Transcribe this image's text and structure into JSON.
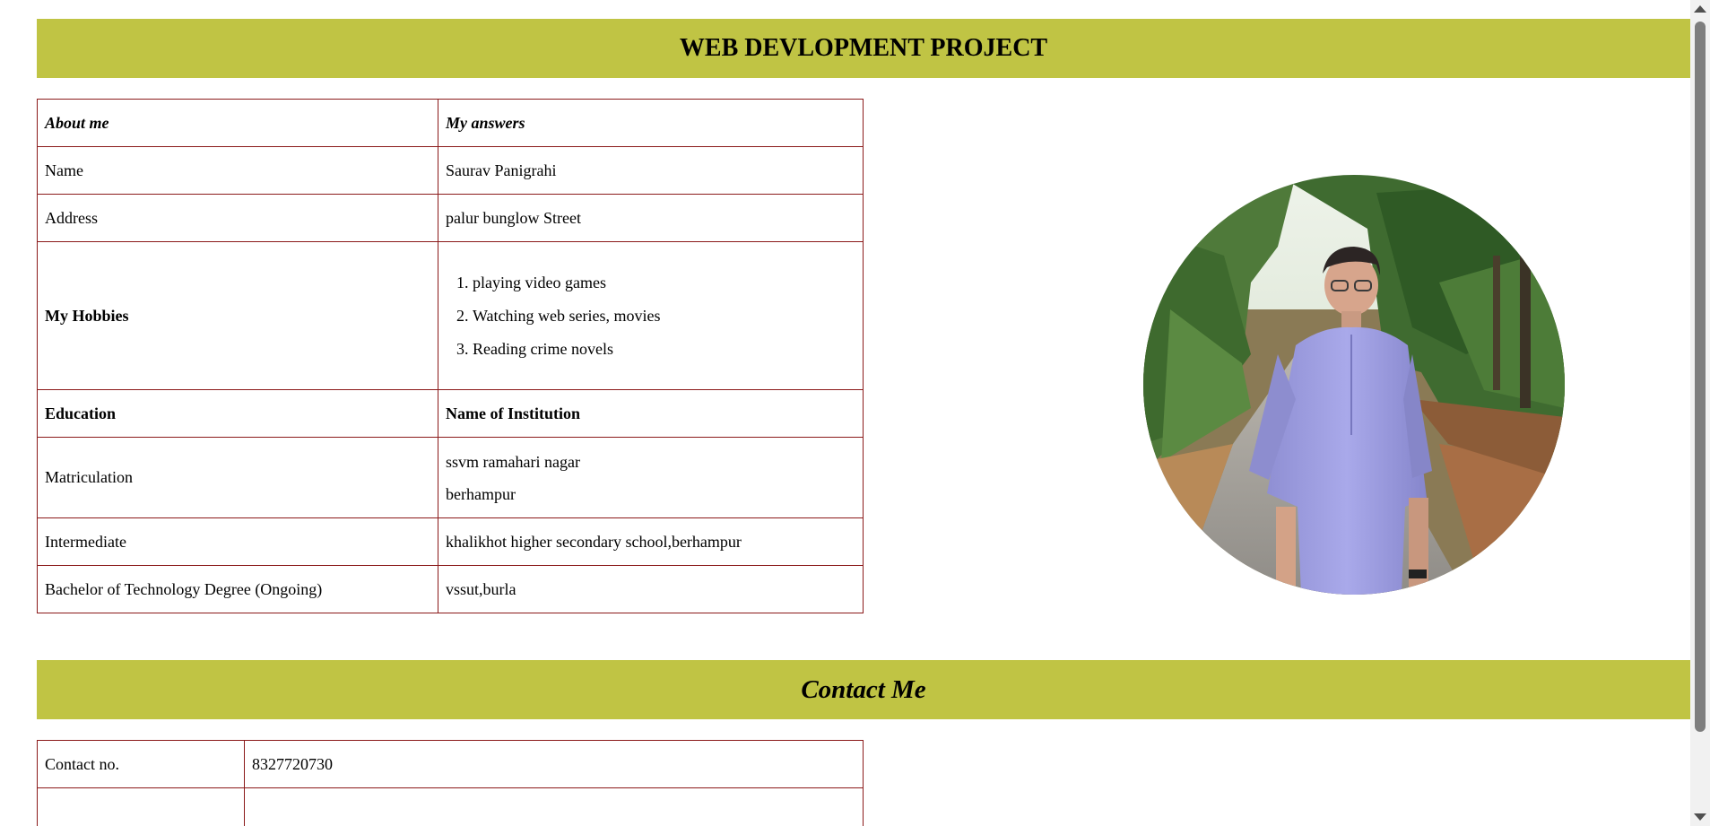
{
  "header": {
    "title": "WEB DEVLOPMENT PROJECT"
  },
  "about": {
    "col_header_left": "About me",
    "col_header_right": "My answers",
    "name_label": "Name",
    "name_value": "Saurav Panigrahi",
    "address_label": "Address",
    "address_value": "palur bunglow Street",
    "hobbies_label": "My Hobbies",
    "hobbies": [
      "playing video games",
      "Watching web series, movies",
      "Reading crime novels"
    ],
    "education_label": "Education",
    "institution_label": "Name of Institution",
    "matric_label": "Matriculation",
    "matric_value_line1": "ssvm ramahari nagar",
    "matric_value_line2": "berhampur",
    "intermediate_label": "Intermediate",
    "intermediate_value": "khalikhot higher secondary school,berhampur",
    "btech_label": "Bachelor of Technology Degree (Ongoing)",
    "btech_value": "vssut,burla"
  },
  "contact": {
    "title": "Contact Me",
    "phone_label": "Contact no.",
    "phone_value": "8327720730"
  },
  "colors": {
    "banner": "#c0c444",
    "table_border": "#8b1a1a"
  }
}
